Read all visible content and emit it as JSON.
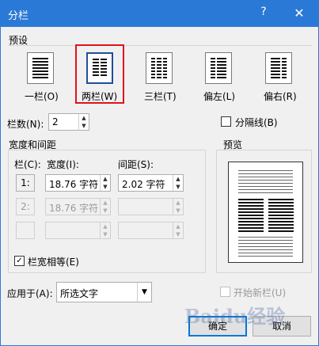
{
  "window": {
    "title": "分栏",
    "help_label": "?",
    "close_label": "✕"
  },
  "presets_group": {
    "label": "预设"
  },
  "presets": [
    {
      "label": "一栏(O)"
    },
    {
      "label": "两栏(W)"
    },
    {
      "label": "三栏(T)"
    },
    {
      "label": "偏左(L)"
    },
    {
      "label": "偏右(R)"
    }
  ],
  "columns_count": {
    "label": "栏数(N):",
    "value": "2"
  },
  "separator": {
    "label": "分隔线(B)",
    "checked": false
  },
  "width_spacing_group": {
    "label": "宽度和间距",
    "col_header": "栏(C):",
    "width_header": "宽度(I):",
    "spacing_header": "间距(S):",
    "rows": [
      {
        "num": "1:",
        "width": "18.76 字符",
        "spacing": "2.02 字符"
      },
      {
        "num": "2:",
        "width": "18.76 字符",
        "spacing": ""
      },
      {
        "num": "",
        "width": "",
        "spacing": ""
      }
    ]
  },
  "equal_width": {
    "label": "栏宽相等(E)",
    "checked": true
  },
  "preview": {
    "label": "预览"
  },
  "apply_to": {
    "label": "应用于(A):",
    "value": "所选文字"
  },
  "new_column": {
    "label": "开始新栏(U)",
    "checked": false
  },
  "buttons": {
    "ok": "确定",
    "cancel": "取消"
  },
  "watermark": "Baidu经验",
  "colors": {
    "title_bar": "#2b79d6",
    "highlight": "#e0131b",
    "dialog_bg": "#f0f0f0"
  }
}
